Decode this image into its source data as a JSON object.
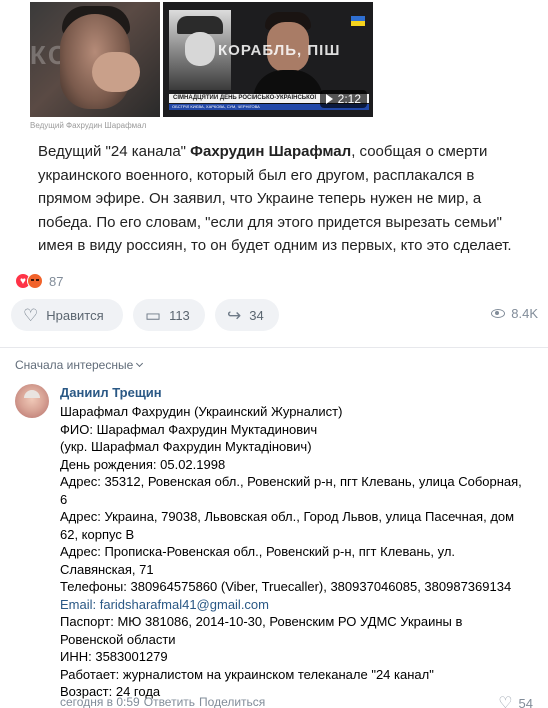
{
  "media": {
    "left_bg_text": "КОЖ",
    "right_overlay_text": "КОРАБЛЬ, ПІШ",
    "right_banner": "СІМНАДЦЯТИЙ ДЕНЬ РОСІЙСЬКО-УКРАЇНСЬКОЇ",
    "right_ticker": "ОБСТРІЛ КИЄВА, ХАРКОВА, СУМ, ЧЕРНІГОВА",
    "duration": "2:12",
    "caption": "Ведущий Фахрудин Шарафмал"
  },
  "post": {
    "text_lead": "Ведущий \"24 канала\" ",
    "text_name": "Фахрудин Шарафмал",
    "text_rest": ", сообщая о смерти украинского военного, который был его другом, расплакался в прямом эфире. Он заявил, что Украине теперь нужен не мир, а победа. По его словам, \"если для этого придется вырезать семьи\" имея в виду россиян, то он будет одним из первых, кто это сделает."
  },
  "reactions": {
    "count": "87",
    "icons": [
      "heart-icon",
      "angry-icon"
    ]
  },
  "actions": {
    "like_label": "Нравится",
    "comments_count": "113",
    "shares_count": "34",
    "views_count": "8.4K"
  },
  "comments": {
    "sort_label": "Сначала интересные",
    "items": [
      {
        "author": "Даниил Трещин",
        "lines": [
          "Шарафмал Фахрудин (Украинский Журналист)",
          "ФИО: Шарафмал Фахрудин Муктадинович",
          "(укр. Шарафмал Фахрудин Муктадінович)",
          "День рождения: 05.02.1998",
          "Адрес: 35312, Ровенская обл., Ровенский р-н, пгт Клевань, улица Соборная,",
          "6",
          "Адрес: Украина, 79038, Львовская обл., Город Львов, улица Пасечная, дом",
          "62, корпус В",
          "Адрес: Прописка-Ровенская обл., Ровенский р-н, пгт Клевань, ул.",
          "Славянская, 71",
          "Телефоны: 380964575860 (Viber, Truecaller), 380937046085, 380987369134",
          "Email: faridsharafmal41@gmail.com",
          "Паспорт: МЮ 381086, 2014-10-30, Ровенским РО УДМС Украины в",
          "Ровенской области",
          "ИНН: 3583001279",
          "Работает: журналистом на украинском телеканале \"24 канал\"",
          "Возраст: 24 года"
        ],
        "time": "сегодня в 0:59",
        "reply": "Ответить",
        "share": "Поделиться",
        "likes": "54"
      }
    ]
  }
}
